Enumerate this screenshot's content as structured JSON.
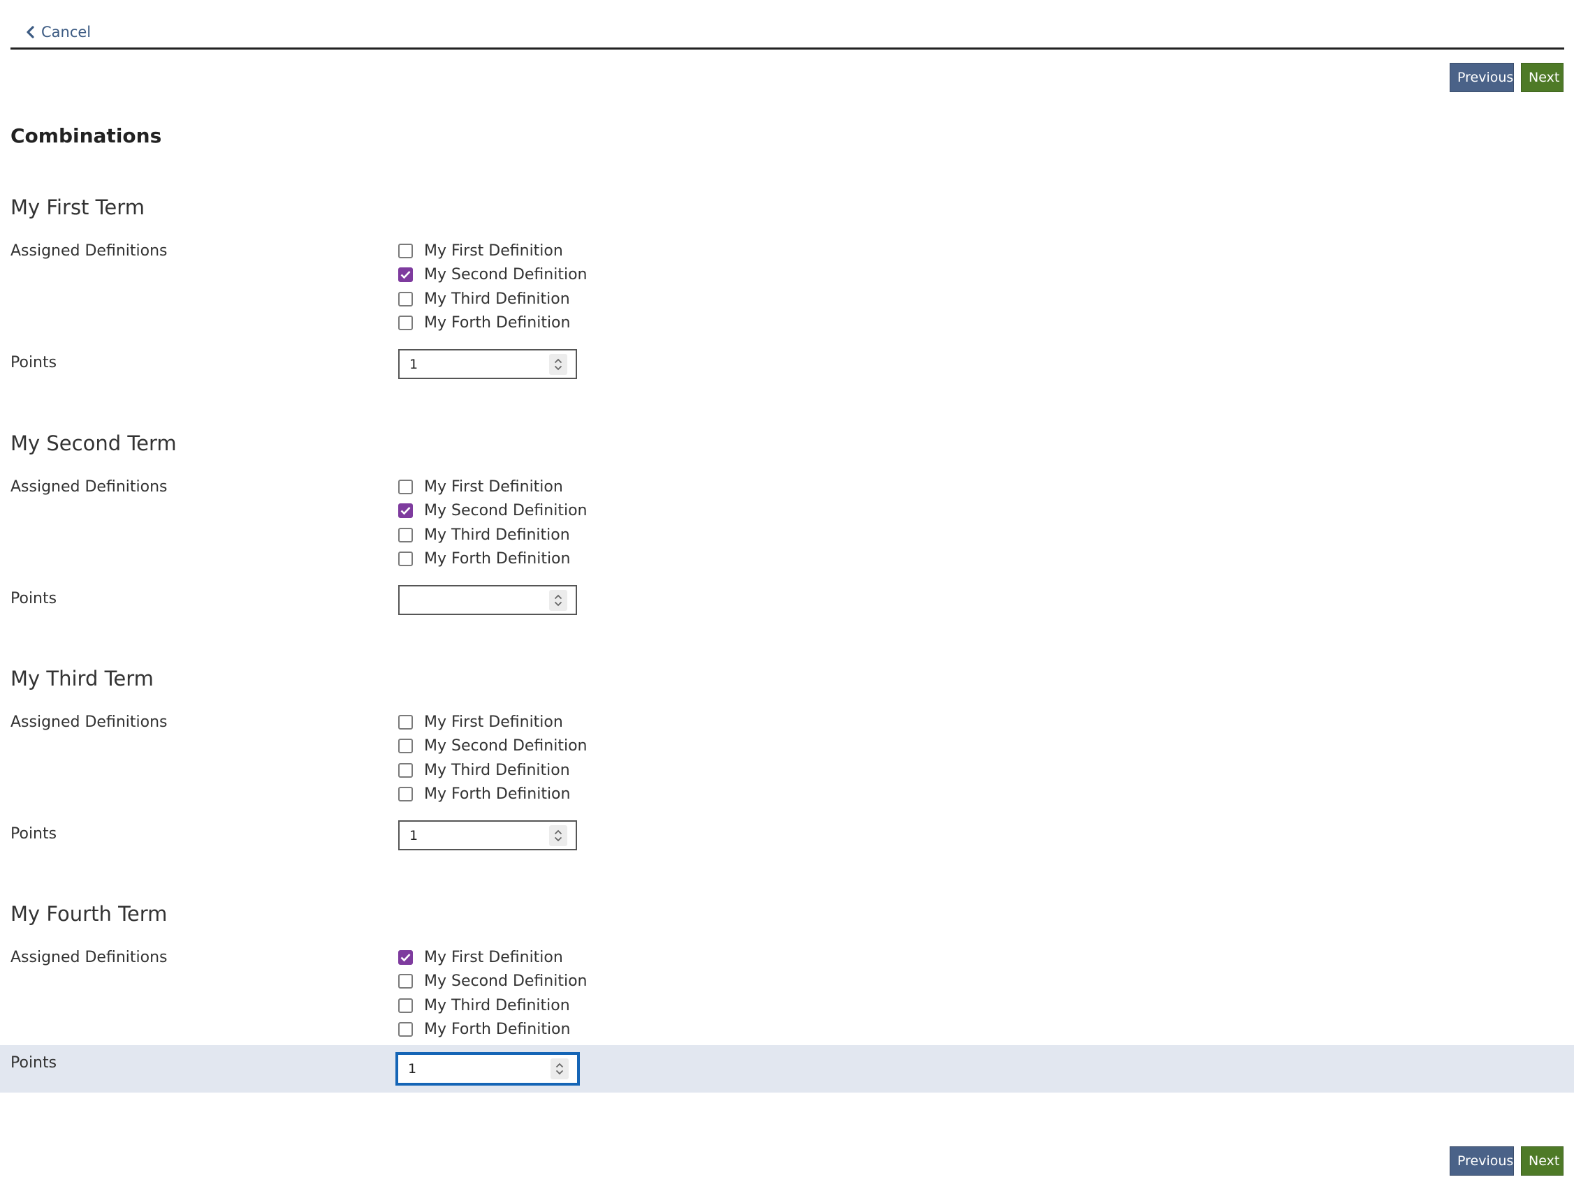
{
  "header": {
    "cancel_label": "Cancel"
  },
  "nav": {
    "previous_label": "Previous",
    "next_label": "Next"
  },
  "section_title": "Combinations",
  "labels": {
    "assigned_definitions": "Assigned Definitions",
    "points": "Points"
  },
  "terms": [
    {
      "title": "My First Term",
      "definitions": [
        {
          "label": "My First Definition",
          "checked": false
        },
        {
          "label": "My Second Definition",
          "checked": true
        },
        {
          "label": "My Third Definition",
          "checked": false
        },
        {
          "label": "My Forth Definition",
          "checked": false
        }
      ],
      "points": "1"
    },
    {
      "title": "My Second Term",
      "definitions": [
        {
          "label": "My First Definition",
          "checked": false
        },
        {
          "label": "My Second Definition",
          "checked": true
        },
        {
          "label": "My Third Definition",
          "checked": false
        },
        {
          "label": "My Forth Definition",
          "checked": false
        }
      ],
      "points": ""
    },
    {
      "title": "My Third Term",
      "definitions": [
        {
          "label": "My First Definition",
          "checked": false
        },
        {
          "label": "My Second Definition",
          "checked": false
        },
        {
          "label": "My Third Definition",
          "checked": false
        },
        {
          "label": "My Forth Definition",
          "checked": false
        }
      ],
      "points": "1"
    },
    {
      "title": "My Fourth Term",
      "definitions": [
        {
          "label": "My First Definition",
          "checked": true
        },
        {
          "label": "My Second Definition",
          "checked": false
        },
        {
          "label": "My Third Definition",
          "checked": false
        },
        {
          "label": "My Forth Definition",
          "checked": false
        }
      ],
      "points": "1",
      "focused": true
    }
  ],
  "icons": {
    "cancel": "chevron-left-icon",
    "checkbox_checked": "checkmark-icon",
    "spinner_up": "chevron-up-icon",
    "spinner_down": "chevron-down-icon"
  },
  "colors": {
    "link": "#3b5a82",
    "previous_button": "#4a6288",
    "next_button": "#4e7a27",
    "checkbox_checked": "#7e3b9e",
    "focus_ring": "#1565b6",
    "focus_row": "#e2e7f0"
  }
}
